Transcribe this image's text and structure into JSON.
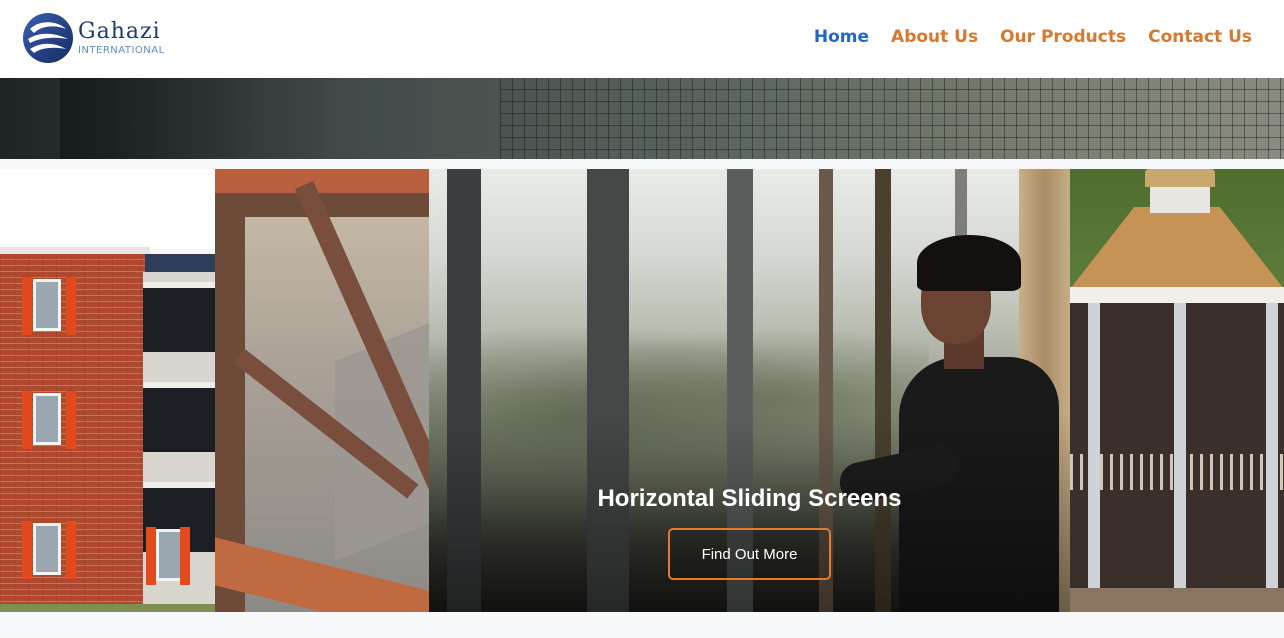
{
  "brand": {
    "name": "Gahazi",
    "subtitle": "INTERNATIONAL",
    "logo_icon": "swirl-logo-icon",
    "primary_color": "#1e3a6e",
    "secondary_color": "#5b8fc9"
  },
  "nav": {
    "items": [
      {
        "label": "Home",
        "active": true
      },
      {
        "label": "About Us",
        "active": false
      },
      {
        "label": "Our Products",
        "active": false
      },
      {
        "label": "Contact Us",
        "active": false
      }
    ],
    "active_color": "#2766c9",
    "link_color": "#d9782d"
  },
  "hero": {
    "title": "Horizontal Sliding Screens",
    "button_label": "Find Out More",
    "button_border_color": "#e07b2f"
  }
}
